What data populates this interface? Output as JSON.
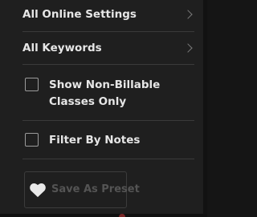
{
  "filters": {
    "online_settings": {
      "label": "All Online Settings",
      "icon": "chevron-right-icon"
    },
    "keywords": {
      "label": "All Keywords",
      "icon": "chevron-right-icon"
    },
    "non_billable": {
      "label": "Show Non-Billable Classes Only",
      "checked": false
    },
    "notes": {
      "label": "Filter By Notes",
      "checked": false
    }
  },
  "preset_button": {
    "label": "Save As Preset",
    "icon": "heart-icon",
    "enabled": false
  }
}
